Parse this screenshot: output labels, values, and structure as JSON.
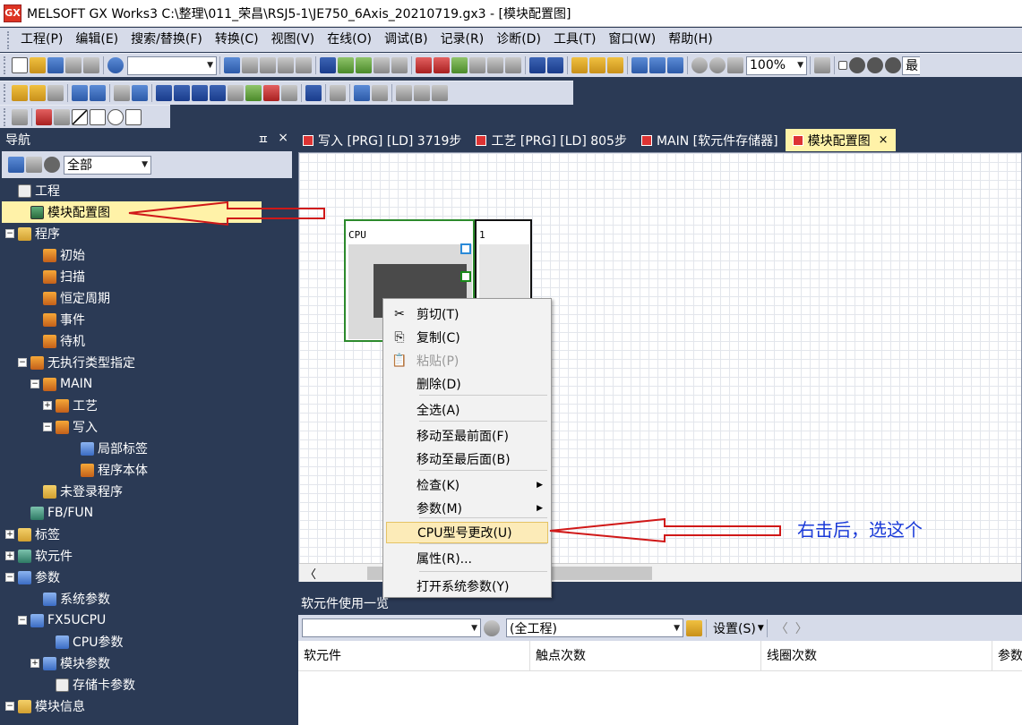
{
  "window": {
    "icon_text": "GX",
    "title": "MELSOFT GX Works3 C:\\整理\\011_荣昌\\RSJ5-1\\JE750_6Axis_20210719.gx3 - [模块配置图]"
  },
  "menu": [
    "工程(P)",
    "编辑(E)",
    "搜索/替换(F)",
    "转换(C)",
    "视图(V)",
    "在线(O)",
    "调试(B)",
    "记录(R)",
    "诊断(D)",
    "工具(T)",
    "窗口(W)",
    "帮助(H)"
  ],
  "toolbar": {
    "zoom": "100%",
    "partial_text": "最"
  },
  "nav": {
    "title": "导航",
    "pin": "ㅍ",
    "close": "×",
    "filter": "全部",
    "tree": [
      {
        "label": "工程",
        "depth": 0,
        "exp": "",
        "icon": "plain"
      },
      {
        "label": "模块配置图",
        "depth": 1,
        "exp": "",
        "icon": "mod-sel",
        "selected": true
      },
      {
        "label": "程序",
        "depth": 0,
        "exp": "−",
        "icon": "folder"
      },
      {
        "label": "初始",
        "depth": 2,
        "exp": "",
        "icon": "prog"
      },
      {
        "label": "扫描",
        "depth": 2,
        "exp": "",
        "icon": "prog"
      },
      {
        "label": "恒定周期",
        "depth": 2,
        "exp": "",
        "icon": "prog"
      },
      {
        "label": "事件",
        "depth": 2,
        "exp": "",
        "icon": "prog"
      },
      {
        "label": "待机",
        "depth": 2,
        "exp": "",
        "icon": "prog"
      },
      {
        "label": "无执行类型指定",
        "depth": 1,
        "exp": "−",
        "icon": "prog"
      },
      {
        "label": "MAIN",
        "depth": 2,
        "exp": "−",
        "icon": "prog"
      },
      {
        "label": "工艺",
        "depth": 3,
        "exp": "+",
        "icon": "prog"
      },
      {
        "label": "写入",
        "depth": 3,
        "exp": "−",
        "icon": "prog"
      },
      {
        "label": "局部标签",
        "depth": 5,
        "exp": "",
        "icon": "param"
      },
      {
        "label": "程序本体",
        "depth": 5,
        "exp": "",
        "icon": "prog"
      },
      {
        "label": "未登录程序",
        "depth": 2,
        "exp": "",
        "icon": "folder"
      },
      {
        "label": "FB/FUN",
        "depth": 1,
        "exp": "",
        "icon": "module"
      },
      {
        "label": "标签",
        "depth": 0,
        "exp": "+",
        "icon": "folder"
      },
      {
        "label": "软元件",
        "depth": 0,
        "exp": "+",
        "icon": "module"
      },
      {
        "label": "参数",
        "depth": 0,
        "exp": "−",
        "icon": "param"
      },
      {
        "label": "系统参数",
        "depth": 2,
        "exp": "",
        "icon": "param"
      },
      {
        "label": "FX5UCPU",
        "depth": 1,
        "exp": "−",
        "icon": "param"
      },
      {
        "label": "CPU参数",
        "depth": 3,
        "exp": "",
        "icon": "param"
      },
      {
        "label": "模块参数",
        "depth": 2,
        "exp": "+",
        "icon": "param"
      },
      {
        "label": "存储卡参数",
        "depth": 3,
        "exp": "",
        "icon": "plain"
      },
      {
        "label": "模块信息",
        "depth": 0,
        "exp": "−",
        "icon": "folder"
      }
    ]
  },
  "tabs": [
    {
      "label": "写入 [PRG] [LD] 3719步",
      "active": false
    },
    {
      "label": "工艺 [PRG] [LD] 805步",
      "active": false
    },
    {
      "label": "MAIN [软元件存储器]",
      "active": false
    },
    {
      "label": "模块配置图",
      "active": true,
      "close": "×"
    }
  ],
  "config": {
    "cpu_label": "CPU",
    "slot_label": "1"
  },
  "context_menu": [
    {
      "label": "剪切(T)",
      "icon": "✂",
      "disabled": false
    },
    {
      "label": "复制(C)",
      "icon": "⎘",
      "disabled": false
    },
    {
      "label": "粘贴(P)",
      "icon": "📋",
      "disabled": true
    },
    {
      "label": "删除(D)",
      "icon": "",
      "disabled": false
    },
    {
      "label": "全选(A)",
      "icon": "",
      "disabled": false
    },
    {
      "label": "移动至最前面(F)",
      "icon": "",
      "disabled": false
    },
    {
      "label": "移动至最后面(B)",
      "icon": "",
      "disabled": false
    },
    {
      "label": "检查(K)",
      "icon": "",
      "disabled": false,
      "submenu": true
    },
    {
      "label": "参数(M)",
      "icon": "",
      "disabled": false,
      "submenu": true
    },
    {
      "label": "CPU型号更改(U)",
      "icon": "",
      "disabled": false,
      "hover": true
    },
    {
      "label": "属性(R)...",
      "icon": "",
      "disabled": false
    },
    {
      "label": "打开系统参数(Y)",
      "icon": "",
      "disabled": false
    }
  ],
  "annotation": {
    "text": "右击后，选这个",
    "color": "#1a3ad8",
    "arrow_color": "#d01818"
  },
  "bottom": {
    "title": "软元件使用一览",
    "scope": "(全工程)",
    "settings": "设置(S)",
    "nav_prev": "〈",
    "nav_next": "〉",
    "columns": [
      "软元件",
      "触点次数",
      "线圈次数",
      "参数"
    ]
  },
  "canvas": {
    "scroll_left": "〈"
  }
}
